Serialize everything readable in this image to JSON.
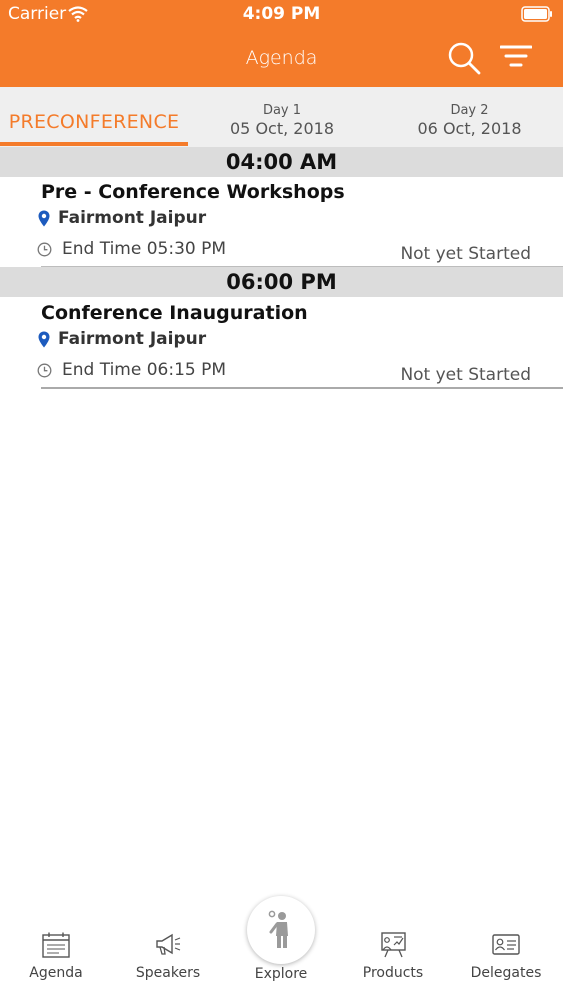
{
  "status_bar": {
    "carrier": "Carrier",
    "time": "4:09 PM"
  },
  "header": {
    "title": "Agenda",
    "accent_color": "#F47B2A"
  },
  "tabs": [
    {
      "label": "PRECONFERENCE",
      "active": true
    },
    {
      "day": "Day 1",
      "date": "05 Oct, 2018",
      "active": false
    },
    {
      "day": "Day 2",
      "date": "06 Oct, 2018",
      "active": false
    }
  ],
  "sessions": [
    {
      "time": "04:00 AM",
      "title": "Pre - Conference Workshops",
      "venue": "Fairmont Jaipur",
      "end_time": "End Time 05:30 PM",
      "status": "Not yet Started"
    },
    {
      "time": "06:00 PM",
      "title": "Conference Inauguration",
      "venue": "Fairmont Jaipur",
      "end_time": "End Time 06:15 PM",
      "status": "Not yet Started"
    }
  ],
  "tabbar": {
    "agenda": "Agenda",
    "speakers": "Speakers",
    "explore": "Explore",
    "products": "Products",
    "delegates": "Delegates"
  }
}
